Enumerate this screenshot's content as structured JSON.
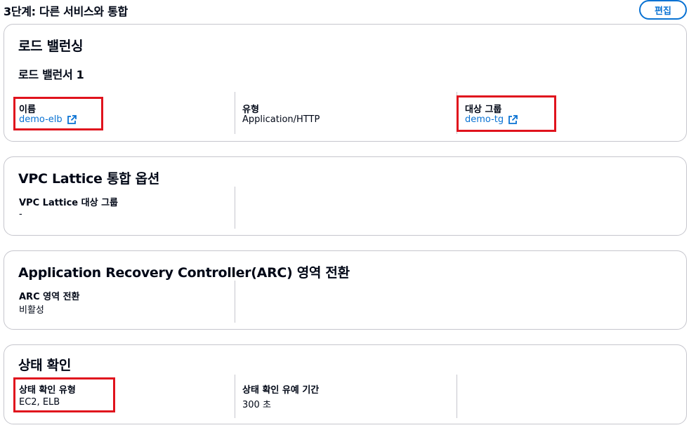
{
  "header": {
    "step_title": "3단계: 다른 서비스와 통합",
    "edit_label": "편집"
  },
  "load_balancing": {
    "title": "로드 밸런싱",
    "subtitle": "로드 밸런서 1",
    "name_label": "이름",
    "name_value": "demo-elb",
    "type_label": "유형",
    "type_value": "Application/HTTP",
    "target_group_label": "대상 그룹",
    "target_group_value": "demo-tg"
  },
  "vpc_lattice": {
    "title": "VPC Lattice 통합 옵션",
    "target_group_label": "VPC Lattice 대상 그룹",
    "target_group_value": "-"
  },
  "arc": {
    "title": "Application Recovery Controller(ARC) 영역 전환",
    "zonal_shift_label": "ARC 영역 전환",
    "zonal_shift_value": "비활성"
  },
  "health_check": {
    "title": "상태 확인",
    "type_label": "상태 확인 유형",
    "type_value": "EC2, ELB",
    "grace_label": "상태 확인 유예 기간",
    "grace_value": "300 초"
  },
  "colors": {
    "link": "#0972d3",
    "highlight": "#e0131d",
    "border": "#c6c6cd"
  }
}
